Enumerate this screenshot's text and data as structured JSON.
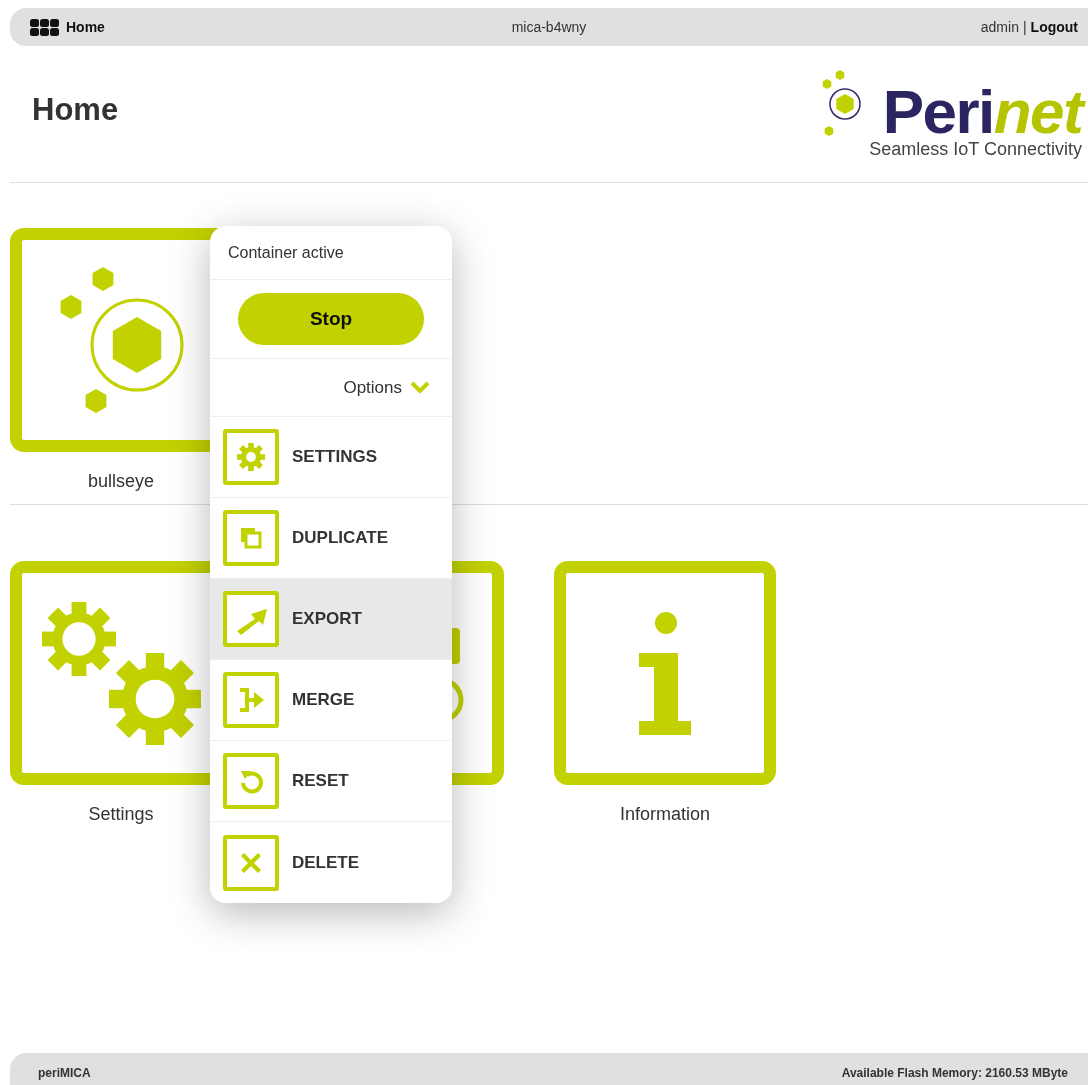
{
  "top_bar": {
    "home_link": "Home",
    "hostname": "mica-b4wny",
    "user": "admin",
    "separator": "|",
    "logout": "Logout"
  },
  "page_title": "Home",
  "logo": {
    "wordmark_start": "Peri",
    "wordmark_end": "net",
    "tagline": "Seamless IoT Connectivity"
  },
  "containers": [
    {
      "label": "bullseye",
      "kind": "container"
    }
  ],
  "apps": [
    {
      "label": "Settings",
      "kind": "settings"
    },
    {
      "kind": "covered"
    },
    {
      "label": "Information",
      "kind": "information"
    }
  ],
  "context_menu": {
    "status": "Container active",
    "primary_button": "Stop",
    "options_toggle": {
      "label": "Options",
      "expanded": true
    },
    "items": [
      {
        "label": "SETTINGS",
        "kind": "settings",
        "selected": false
      },
      {
        "label": "DUPLICATE",
        "kind": "duplicate",
        "selected": false
      },
      {
        "label": "EXPORT",
        "kind": "export",
        "selected": true
      },
      {
        "label": "MERGE",
        "kind": "merge",
        "selected": false
      },
      {
        "label": "RESET",
        "kind": "reset",
        "selected": false
      },
      {
        "label": "DELETE",
        "kind": "delete",
        "selected": false
      }
    ]
  },
  "footer": {
    "product": "periMICA",
    "memory": "Available Flash Memory: 2160.53 MByte"
  }
}
